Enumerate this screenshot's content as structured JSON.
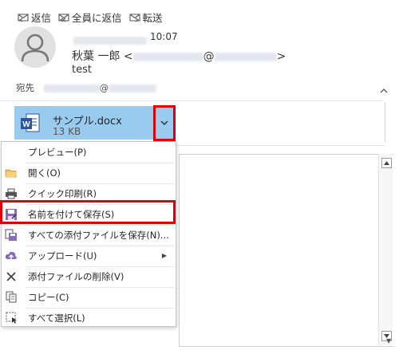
{
  "actions": {
    "reply": "返信",
    "reply_all": "全員に返信",
    "forward": "転送"
  },
  "message": {
    "time": "10:07",
    "sender_name": "秋葉 一郎 <",
    "sender_at": "@",
    "sender_close": ">",
    "subject": "test",
    "to_label": "宛先",
    "to_at": "@"
  },
  "attachment": {
    "name": "サンプル.docx",
    "size": "13 KB"
  },
  "context_menu": {
    "preview": "プレビュー(P)",
    "open": "開く(O)",
    "quick_print": "クイック印刷(R)",
    "save_as": "名前を付けて保存(S)",
    "save_all": "すべての添付ファイルを保存(N)...",
    "upload": "アップロード(U)",
    "remove": "添付ファイルの削除(V)",
    "copy": "コピー(C)",
    "select_all": "すべて選択(L)"
  },
  "colors": {
    "attachment_bg": "#99cbef",
    "highlight": "#e0000a",
    "word_blue": "#2b579a"
  },
  "icons": [
    "reply-icon",
    "reply-all-icon",
    "forward-icon",
    "avatar-icon",
    "word-icon",
    "chevron-down-icon",
    "folder-icon",
    "printer-icon",
    "save-as-icon",
    "save-all-icon",
    "upload-icon",
    "delete-icon",
    "copy-icon",
    "select-all-icon"
  ]
}
